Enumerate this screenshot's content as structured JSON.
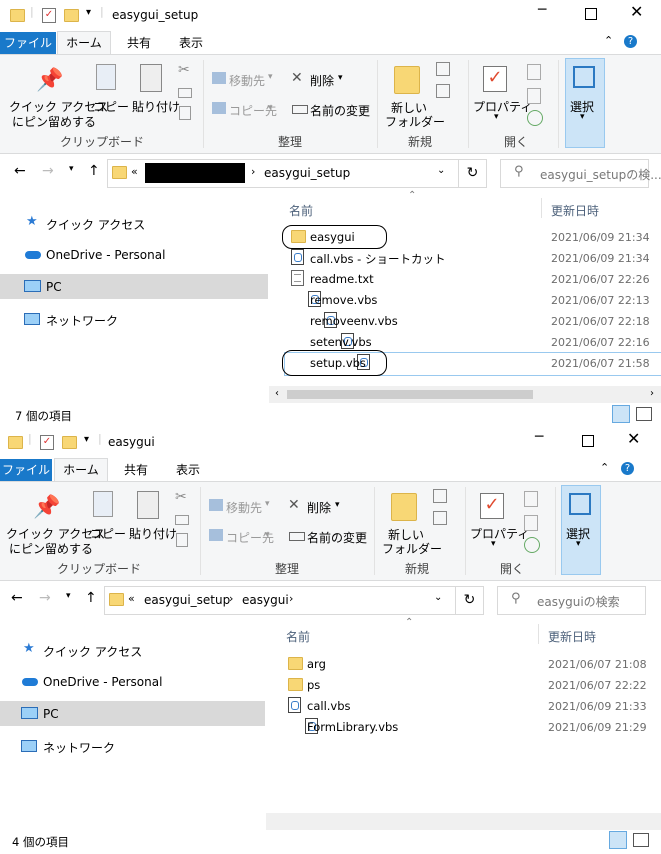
{
  "windows": [
    {
      "title": "easygui_setup",
      "ribbon_tabs": [
        "ファイル",
        "ホーム",
        "共有",
        "表示"
      ],
      "clipboard": {
        "pin_l1": "クイック アクセス",
        "pin_l2": "にピン留めする",
        "copy": "コピー",
        "paste": "貼り付け",
        "group": "クリップボード"
      },
      "organize": {
        "move": "移動先",
        "copy_to": "コピー先",
        "delete": "削除",
        "rename": "名前の変更",
        "group": "整理"
      },
      "new": {
        "folder_l1": "新しい",
        "folder_l2": "フォルダー",
        "group": "新規"
      },
      "open": {
        "properties": "プロパティ",
        "group": "開く"
      },
      "select": {
        "label": "選択"
      },
      "address": {
        "chevrons": "«",
        "crumbs": [
          "",
          "easygui_setup"
        ]
      },
      "search_placeholder": "easygui_setupの検...",
      "nav": [
        "クイック アクセス",
        "OneDrive - Personal",
        "PC",
        "ネットワーク"
      ],
      "columns": {
        "name": "名前",
        "modified": "更新日時"
      },
      "files": [
        {
          "name": "easygui",
          "type": "folder",
          "date": "2021/06/09 21:34"
        },
        {
          "name": "call.vbs - ショートカット",
          "type": "vbs",
          "date": "2021/06/09 21:34"
        },
        {
          "name": "readme.txt",
          "type": "txt",
          "date": "2021/06/07 22:26"
        },
        {
          "name": "remove.vbs",
          "type": "vbs",
          "date": "2021/06/07 22:13"
        },
        {
          "name": "removeenv.vbs",
          "type": "vbs",
          "date": "2021/06/07 22:18"
        },
        {
          "name": "setenv.vbs",
          "type": "vbs",
          "date": "2021/06/07 22:16"
        },
        {
          "name": "setup.vbs",
          "type": "vbs",
          "date": "2021/06/07 21:58"
        }
      ],
      "status": "7 個の項目"
    },
    {
      "title": "easygui",
      "ribbon_tabs": [
        "ファイル",
        "ホーム",
        "共有",
        "表示"
      ],
      "clipboard": {
        "pin_l1": "クイック アクセス",
        "pin_l2": "にピン留めする",
        "copy": "コピー",
        "paste": "貼り付け",
        "group": "クリップボード"
      },
      "organize": {
        "move": "移動先",
        "copy_to": "コピー先",
        "delete": "削除",
        "rename": "名前の変更",
        "group": "整理"
      },
      "new": {
        "folder_l1": "新しい",
        "folder_l2": "フォルダー",
        "group": "新規"
      },
      "open": {
        "properties": "プロパティ",
        "group": "開く"
      },
      "select": {
        "label": "選択"
      },
      "address": {
        "chevrons": "«",
        "crumbs": [
          "easygui_setup",
          "easygui"
        ]
      },
      "search_placeholder": "easyguiの検索",
      "nav": [
        "クイック アクセス",
        "OneDrive - Personal",
        "PC",
        "ネットワーク"
      ],
      "columns": {
        "name": "名前",
        "modified": "更新日時"
      },
      "files": [
        {
          "name": "arg",
          "type": "folder",
          "date": "2021/06/07 21:08"
        },
        {
          "name": "ps",
          "type": "folder",
          "date": "2021/06/07 22:22"
        },
        {
          "name": "call.vbs",
          "type": "vbs",
          "date": "2021/06/09 21:33"
        },
        {
          "name": "FormLibrary.vbs",
          "type": "vbs",
          "date": "2021/06/09 21:29"
        }
      ],
      "status": "4 個の項目"
    }
  ]
}
